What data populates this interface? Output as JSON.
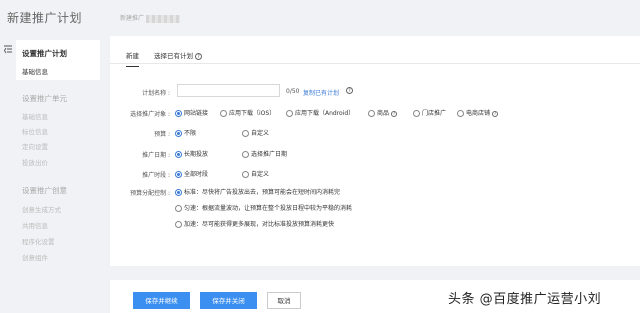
{
  "header": {
    "title": "新建推广计划",
    "breadcrumb": "新建推广"
  },
  "sidebar": {
    "group1_title": "设置推广计划",
    "group1_items": [
      "基础信息"
    ],
    "group2_title": "设置推广单元",
    "group2_items": [
      "基础信息",
      "标位信息",
      "定向设置",
      "投放出价"
    ],
    "group3_title": "设置推广创意",
    "group3_items": [
      "创意生成方式",
      "共用信息",
      "程序化设置",
      "创意组件"
    ]
  },
  "tabs": [
    {
      "label": "新建",
      "active": true
    },
    {
      "label": "选择已有计划",
      "active": false
    }
  ],
  "form": {
    "name": {
      "label": "计划名称 :",
      "placeholder": "",
      "count": "0/50",
      "copy_link": "复制已有计划"
    },
    "target": {
      "label": "选择推广对象 :",
      "options": [
        "网站链接",
        "应用下载（iOS）",
        "应用下载（Android）",
        "商品",
        "门店推广",
        "电商店铺"
      ],
      "selected": "网站链接"
    },
    "budget": {
      "label": "预算 :",
      "options": [
        "不限",
        "自定义"
      ],
      "selected": "不限"
    },
    "date": {
      "label": "推广日期 :",
      "options": [
        "长期投放",
        "选择推广日期"
      ],
      "selected": "长期投放"
    },
    "time": {
      "label": "推广时段 :",
      "options": [
        "全部时段",
        "自定义"
      ],
      "selected": "全部时段"
    },
    "allocation": {
      "label": "预算分配控制 :",
      "options": [
        "标准：尽快将广告投放出去，预算可能会在短时间内消耗完",
        "匀速：根据流量波动，让预算在整个投放日程中较为平稳的消耗",
        "加速：尽可能获得更多展现，对比标准投放预算消耗更快"
      ],
      "selected": 0
    }
  },
  "footer": {
    "save_continue": "保存并继续",
    "save_close": "保存并关闭",
    "cancel": "取消"
  },
  "watermark": "头条 @百度推广运营小刘",
  "colors": {
    "accent": "#3b8ff0",
    "link": "#3a7bd5",
    "background": "#f1f2f5"
  }
}
